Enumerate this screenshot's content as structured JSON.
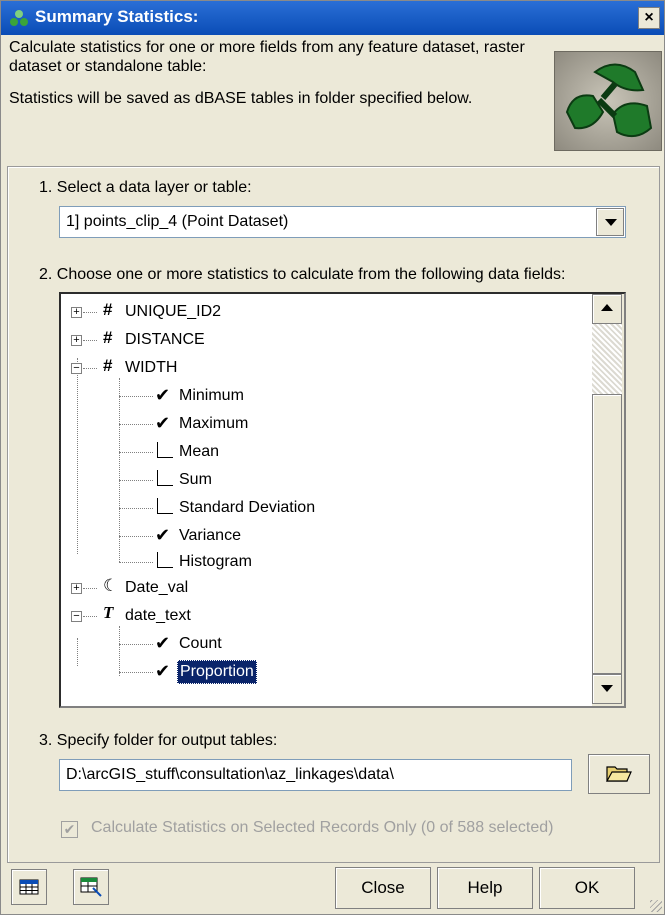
{
  "window": {
    "title": "Summary Statistics:",
    "close_label": "×"
  },
  "intro": {
    "line1": "Calculate statistics for one or more fields from any feature dataset, raster dataset or standalone table:",
    "line2": "Statistics will be saved as dBASE tables in folder specified below."
  },
  "step1": {
    "label": "1.  Select a data layer or table:",
    "selected_layer": "1] points_clip_4  (Point Dataset)"
  },
  "step2": {
    "label": "2.  Choose one or more statistics to calculate from the following data fields:",
    "fields": [
      {
        "type_icon": "#",
        "name": "UNIQUE_ID2",
        "expanded": false
      },
      {
        "type_icon": "#",
        "name": "DISTANCE",
        "expanded": false
      },
      {
        "type_icon": "#",
        "name": "WIDTH",
        "expanded": true
      },
      {
        "type_icon": "☾",
        "name": "Date_val",
        "expanded": false
      },
      {
        "type_icon": "T",
        "name": "date_text",
        "expanded": true
      }
    ],
    "width_stats": [
      {
        "label": "Minimum",
        "checked": true
      },
      {
        "label": "Maximum",
        "checked": true
      },
      {
        "label": "Mean",
        "checked": false
      },
      {
        "label": "Sum",
        "checked": false
      },
      {
        "label": "Standard Deviation",
        "checked": false
      },
      {
        "label": "Variance",
        "checked": true
      },
      {
        "label": "Histogram",
        "checked": false
      }
    ],
    "date_text_stats": [
      {
        "label": "Count",
        "checked": true
      },
      {
        "label": "Proportion",
        "checked": true,
        "selected": true
      }
    ]
  },
  "step3": {
    "label": "3.  Specify folder for output tables:",
    "folder_path": "D:\\arcGIS_stuff\\consultation\\az_linkages\\data\\"
  },
  "selected_only": {
    "label": "Calculate Statistics on Selected Records Only (0 of 588 selected)",
    "checked": true,
    "disabled": true
  },
  "buttons": {
    "close": "Close",
    "help": "Help",
    "ok": "OK"
  },
  "colors": {
    "titlebar": "#0a4cb6",
    "dialog_bg": "#ece9d8",
    "selection": "#0a246a",
    "disabled_text": "#a0a0a0"
  }
}
